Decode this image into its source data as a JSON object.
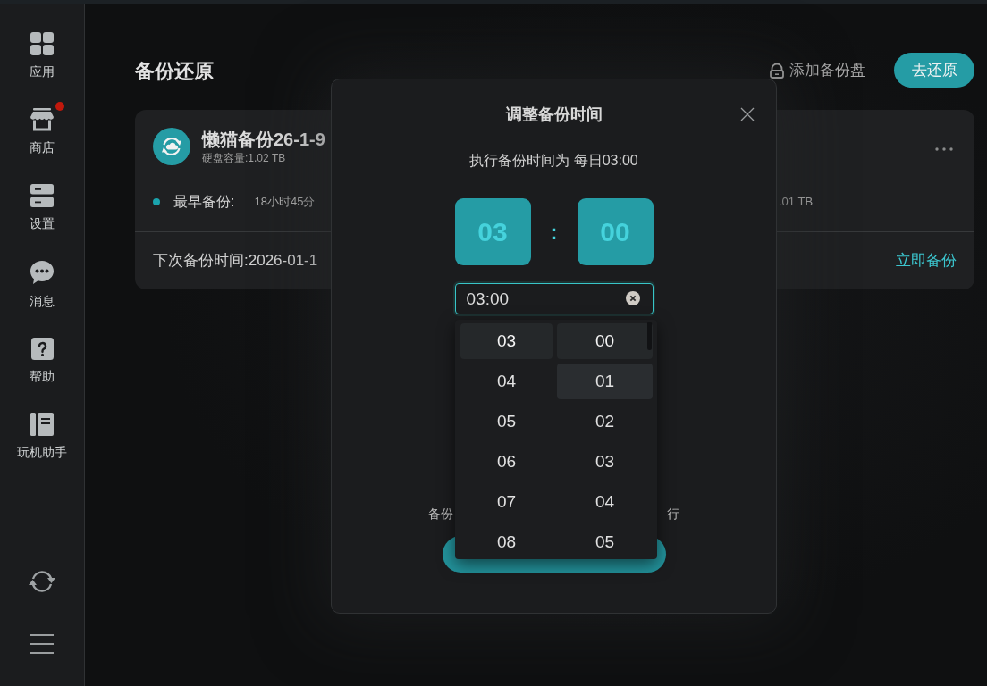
{
  "sidebar": {
    "items": [
      {
        "label": "应用",
        "badge": false
      },
      {
        "label": "商店",
        "badge": true
      },
      {
        "label": "设置",
        "badge": false
      },
      {
        "label": "消息",
        "badge": false
      },
      {
        "label": "帮助",
        "badge": false
      },
      {
        "label": "玩机助手",
        "badge": false
      }
    ]
  },
  "page": {
    "title": "备份还原",
    "add_disk_button": "添加备份盘",
    "restore_button": "去还原"
  },
  "backup_card": {
    "name": "懒猫备份26-1-9",
    "capacity": "硬盘容量:1.02 TB",
    "earliest_label": "最早备份:",
    "earliest_value": "18小时45分",
    "column_2_value": ".01 TB",
    "next_backup": "下次备份时间:2026-01-1",
    "backup_now_link": "立即备份"
  },
  "dialog": {
    "title": "调整备份时间",
    "summary": "执行备份时间为 每日03:00",
    "hour": "03",
    "separator": ":",
    "minute": "00",
    "time_input": {
      "value": "03:00"
    },
    "note_left": "备份",
    "note_right": "行"
  },
  "time_picker": {
    "hours": [
      {
        "label": "03",
        "selected": true
      },
      {
        "label": "04",
        "selected": false
      },
      {
        "label": "05",
        "selected": false
      },
      {
        "label": "06",
        "selected": false
      },
      {
        "label": "07",
        "selected": false
      },
      {
        "label": "08",
        "selected": false
      }
    ],
    "minutes": [
      {
        "label": "00",
        "selected": true,
        "hovered": false
      },
      {
        "label": "01",
        "selected": false,
        "hovered": true
      },
      {
        "label": "02",
        "selected": false,
        "hovered": false
      },
      {
        "label": "03",
        "selected": false,
        "hovered": false
      },
      {
        "label": "04",
        "selected": false,
        "hovered": false
      },
      {
        "label": "05",
        "selected": false,
        "hovered": false
      }
    ]
  }
}
